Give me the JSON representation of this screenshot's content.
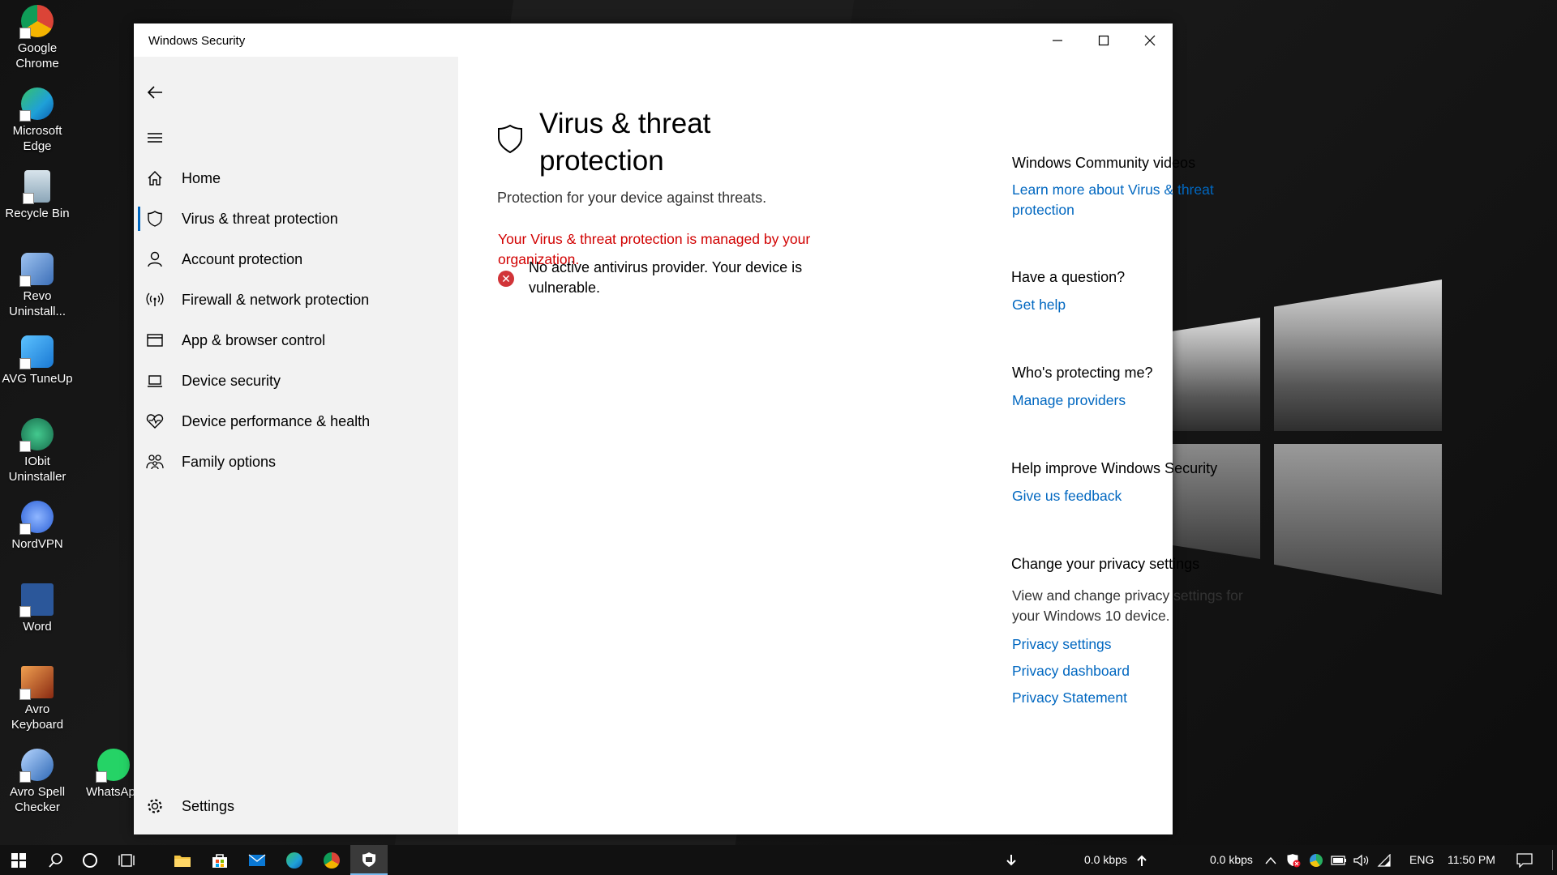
{
  "desktop": {
    "icons": [
      {
        "label": "Google Chrome",
        "color": "#db4437"
      },
      {
        "label": "Microsoft Edge",
        "color": "#1fa0d8"
      },
      {
        "label": "Recycle Bin",
        "color": "#9cb7c9"
      },
      {
        "label": "Revo Uninstall...",
        "color": "#5b8fd1"
      },
      {
        "label": "AVG TuneUp",
        "color": "#2c9be6"
      },
      {
        "label": "IObit Uninstaller",
        "color": "#2fb07a"
      },
      {
        "label": "NordVPN",
        "color": "#4687ff"
      },
      {
        "label": "Word",
        "color": "#2b579a"
      },
      {
        "label": "Avro Keyboard",
        "color": "#c0532a"
      },
      {
        "label": "Avro Spell Checker",
        "color": "#3a76c4"
      },
      {
        "label": "WhatsApp",
        "color": "#25d366"
      }
    ]
  },
  "window": {
    "title": "Windows Security",
    "minimize_icon": "minimize-icon",
    "maximize_icon": "maximize-icon",
    "close_icon": "close-icon"
  },
  "sidebar": {
    "back_icon": "back-arrow-icon",
    "menu_icon": "hamburger-menu-icon",
    "items": [
      {
        "label": "Home",
        "icon": "home-icon"
      },
      {
        "label": "Virus & threat protection",
        "icon": "shield-icon",
        "active": true
      },
      {
        "label": "Account protection",
        "icon": "person-icon"
      },
      {
        "label": "Firewall & network protection",
        "icon": "antenna-icon"
      },
      {
        "label": "App & browser control",
        "icon": "browser-window-icon"
      },
      {
        "label": "Device security",
        "icon": "laptop-icon"
      },
      {
        "label": "Device performance & health",
        "icon": "heart-pulse-icon"
      },
      {
        "label": "Family options",
        "icon": "family-icon"
      }
    ],
    "settings_label": "Settings"
  },
  "main": {
    "title": "Virus & threat protection",
    "subtitle": "Protection for your device against threats.",
    "managed_notice": "Your Virus & threat protection is managed by your organization.",
    "alert_text": "No active antivirus provider. Your device is vulnerable."
  },
  "side_panel": {
    "community_heading": "Windows Community videos",
    "community_link": "Learn more about Virus & threat protection",
    "question_heading": "Have a question?",
    "question_link": "Get help",
    "protecting_heading": "Who's protecting me?",
    "protecting_link": "Manage providers",
    "improve_heading": "Help improve Windows Security",
    "improve_link": "Give us feedback",
    "privacy_heading": "Change your privacy settings",
    "privacy_text": "View and change privacy settings for your Windows 10 device.",
    "privacy_links": [
      "Privacy settings",
      "Privacy dashboard",
      "Privacy Statement"
    ]
  },
  "taskbar": {
    "download_speed": "0.0 kbps",
    "upload_speed": "0.0 kbps",
    "language": "ENG",
    "time": "11:50 PM"
  },
  "colors": {
    "accent": "#0067c0",
    "error": "#d10000",
    "sidebar_bg": "#f2f2f2",
    "taskbar_bg": "#111111"
  }
}
